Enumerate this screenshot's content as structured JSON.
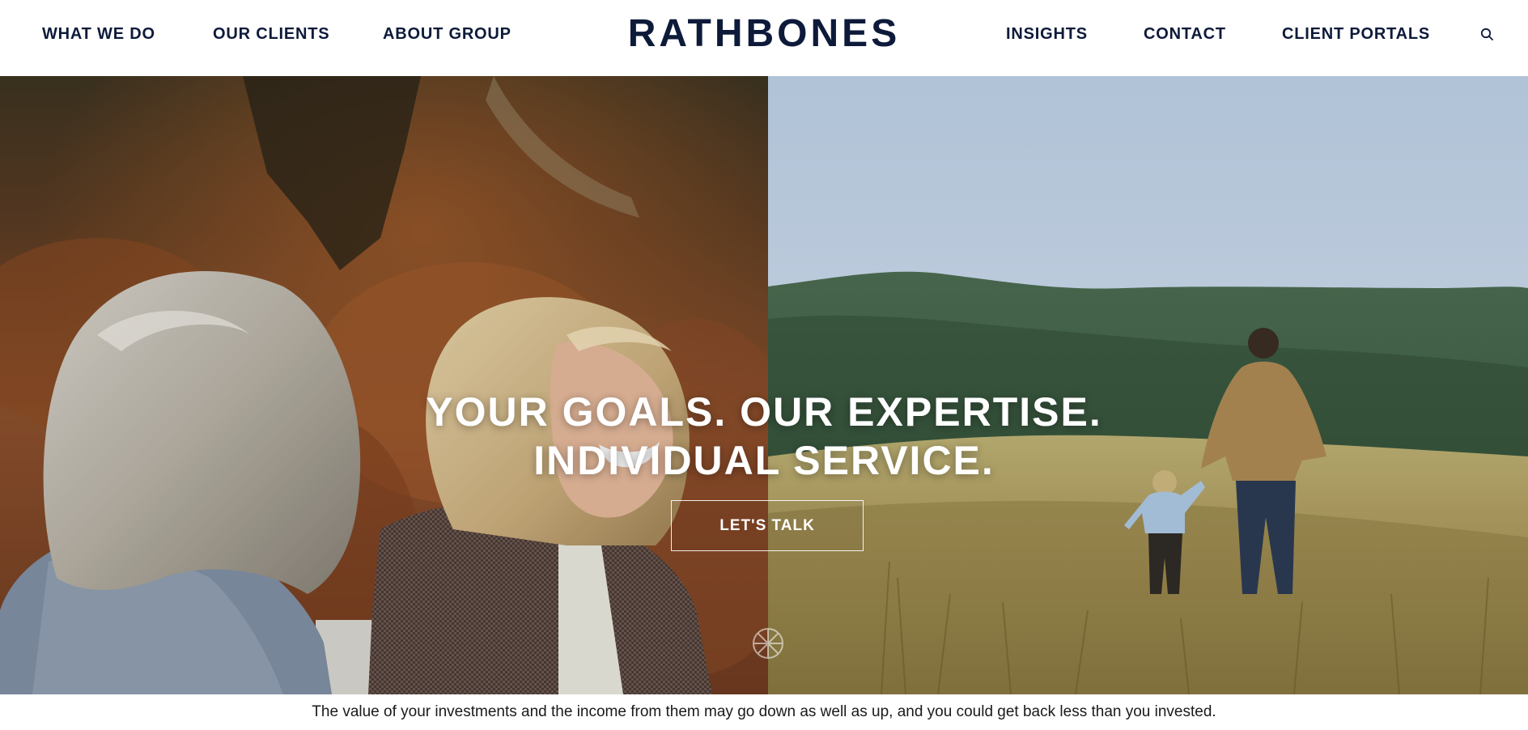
{
  "header": {
    "logo": "RATHBONES",
    "nav_left": [
      {
        "label": "WHAT WE DO"
      },
      {
        "label": "OUR CLIENTS"
      },
      {
        "label": "ABOUT GROUP"
      }
    ],
    "nav_right": [
      {
        "label": "INSIGHTS"
      },
      {
        "label": "CONTACT"
      },
      {
        "label": "CLIENT PORTALS"
      }
    ],
    "search_icon": "search-icon"
  },
  "hero": {
    "headline_line1": "YOUR GOALS. OUR EXPERTISE.",
    "headline_line2": "INDIVIDUAL SERVICE.",
    "cta_label": "LET'S TALK",
    "left_image": "two-women-talking-autumn-bracken",
    "right_image": "father-and-child-walking-meadow-hills",
    "mark_icon": "rathbones-emblem-icon"
  },
  "footer": {
    "disclaimer": "The value of your investments and the income from them may go down as well as up, and you could get back less than you invested."
  },
  "colors": {
    "brand_navy": "#0d1a3a",
    "header_bg": "#ffffff",
    "hero_text": "#ffffff"
  }
}
